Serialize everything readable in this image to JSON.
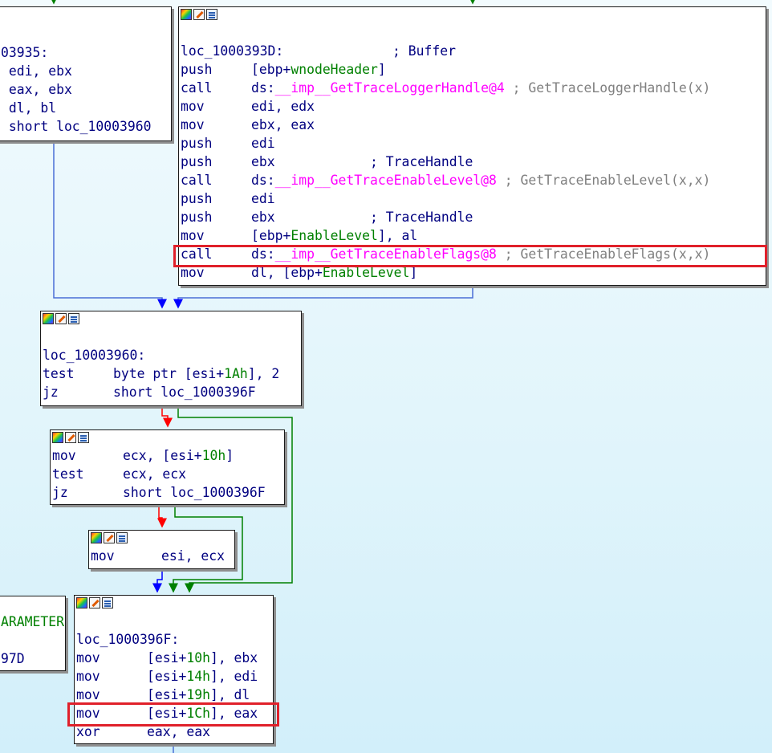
{
  "nodes": {
    "top_left": {
      "lines": [
        "03935:",
        " edi, ebx",
        " eax, ebx",
        " dl, bl",
        " short loc_10003960"
      ]
    },
    "trace_block": {
      "label": "loc_1000393D:",
      "label_comment": "; Buffer",
      "rows": [
        {
          "mn": "push",
          "pre": "[ebp+",
          "sym": "wnodeHeader",
          "post": "]",
          "cmt": ""
        },
        {
          "mn": "call",
          "pre": "ds:",
          "sym": "__imp__GetTraceLoggerHandle@4",
          "post": " ",
          "cmt": "; GetTraceLoggerHandle(x)"
        },
        {
          "mn": "mov",
          "pre": "edi, edx",
          "sym": "",
          "post": "",
          "cmt": ""
        },
        {
          "mn": "mov",
          "pre": "ebx, eax",
          "sym": "",
          "post": "",
          "cmt": ""
        },
        {
          "mn": "push",
          "pre": "edi",
          "sym": "",
          "post": "",
          "cmt": ""
        },
        {
          "mn": "push",
          "pre": "ebx            ",
          "sym": "",
          "post": "",
          "cmt": "; TraceHandle"
        },
        {
          "mn": "call",
          "pre": "ds:",
          "sym": "__imp__GetTraceEnableLevel@8",
          "post": " ",
          "cmt": "; GetTraceEnableLevel(x,x)"
        },
        {
          "mn": "push",
          "pre": "edi",
          "sym": "",
          "post": "",
          "cmt": ""
        },
        {
          "mn": "push",
          "pre": "ebx            ",
          "sym": "",
          "post": "",
          "cmt": "; TraceHandle"
        },
        {
          "mn": "mov",
          "pre": "[ebp+",
          "sym": "EnableLevel",
          "post": "], al",
          "cmt": ""
        },
        {
          "mn": "call",
          "pre": "ds:",
          "sym": "__imp__GetTraceEnableFlags@8",
          "post": " ",
          "cmt": "; GetTraceEnableFlags(x,x)"
        },
        {
          "mn": "mov",
          "pre": "dl, [ebp+",
          "sym": "EnableLevel",
          "post": "]",
          "cmt": ""
        }
      ]
    },
    "loc3960": {
      "label": "loc_10003960:",
      "rows": [
        {
          "mn": "test",
          "pre": "byte ptr [esi+",
          "sym": "1Ah",
          "post": "], 2"
        },
        {
          "mn": "jz",
          "pre": "short loc_1000396F",
          "sym": "",
          "post": ""
        }
      ]
    },
    "ecx_block": {
      "rows": [
        {
          "mn": "mov",
          "pre": "ecx, [esi+",
          "sym": "10h",
          "post": "]"
        },
        {
          "mn": "test",
          "pre": "ecx, ecx",
          "sym": "",
          "post": ""
        },
        {
          "mn": "jz",
          "pre": "short loc_1000396F",
          "sym": "",
          "post": ""
        }
      ]
    },
    "esi_block": {
      "rows": [
        {
          "mn": "mov",
          "pre": "esi, ecx",
          "sym": "",
          "post": ""
        }
      ]
    },
    "side_left": {
      "lines": [
        "ARAMETER",
        "",
        "97D"
      ]
    },
    "loc396F": {
      "label": "loc_1000396F:",
      "rows": [
        {
          "mn": "mov",
          "pre": "[esi+",
          "sym": "10h",
          "post": "], ebx"
        },
        {
          "mn": "mov",
          "pre": "[esi+",
          "sym": "14h",
          "post": "], edi"
        },
        {
          "mn": "mov",
          "pre": "[esi+",
          "sym": "19h",
          "post": "], dl"
        },
        {
          "mn": "mov",
          "pre": "[esi+",
          "sym": "1Ch",
          "post": "], eax"
        },
        {
          "mn": "xor",
          "pre": "eax, eax",
          "sym": "",
          "post": ""
        }
      ]
    }
  },
  "colors": {
    "edge_true": "#008000",
    "edge_false": "#ff0000",
    "edge_uncond": "#0000ff",
    "edge_line": "#4a6fd6",
    "highlight": "#e0202a",
    "symbol_pink": "#ff00ff",
    "symbol_green": "#008000",
    "text": "#000080",
    "comment_gray": "#808080"
  },
  "header_icons": [
    "graph-icon",
    "edit-icon",
    "list-icon"
  ]
}
